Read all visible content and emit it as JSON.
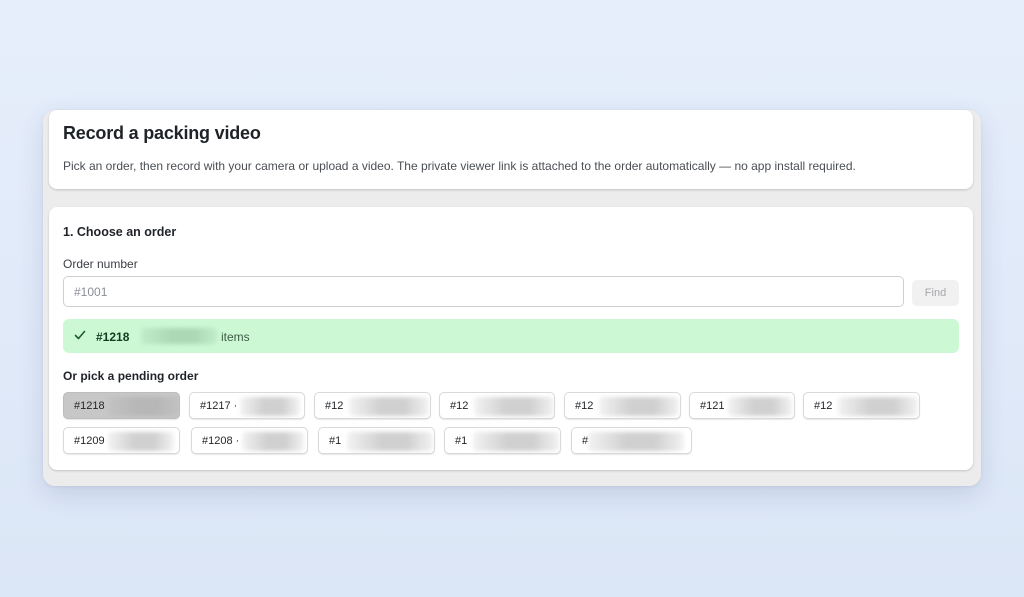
{
  "header": {
    "title": "Record a packing video",
    "description": "Pick an order, then record with your camera or upload a video. The private viewer link is attached to the order automatically — no app install required."
  },
  "step1": {
    "title": "1. Choose an order",
    "field_label": "Order number",
    "input_placeholder": "#1001",
    "input_value": "",
    "find_label": "Find"
  },
  "selected": {
    "icon": "check-icon",
    "order": "#1218",
    "items_text": "items",
    "accent": "#ccf8d4"
  },
  "pending": {
    "title": "Or pick a pending order",
    "orders": [
      {
        "label": "#1218",
        "active": true
      },
      {
        "label": "#1217 ·",
        "active": false
      },
      {
        "label": "#12",
        "active": false
      },
      {
        "label": "#12",
        "active": false
      },
      {
        "label": "#12",
        "active": false
      },
      {
        "label": "#121",
        "active": false
      },
      {
        "label": "#12",
        "active": false
      },
      {
        "label": "#1209",
        "active": false
      },
      {
        "label": "#1208 ·",
        "active": false
      },
      {
        "label": "#1",
        "active": false
      },
      {
        "label": "#1",
        "active": false
      },
      {
        "label": "#",
        "active": false
      }
    ]
  }
}
